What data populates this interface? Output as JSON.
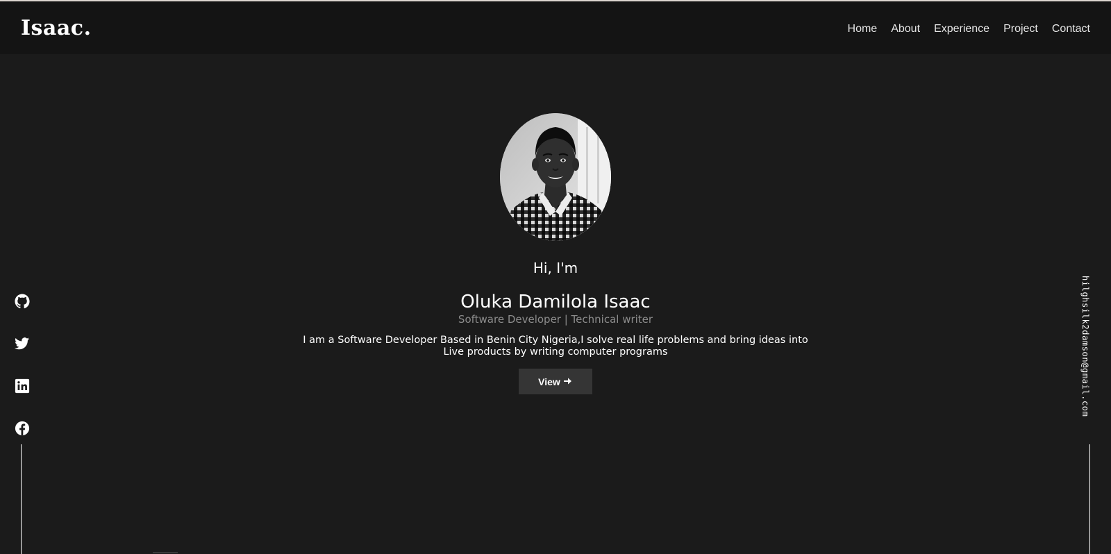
{
  "brand": {
    "name": "Isaac."
  },
  "nav": {
    "items": [
      {
        "label": "Home"
      },
      {
        "label": "About"
      },
      {
        "label": "Experience"
      },
      {
        "label": "Project"
      },
      {
        "label": "Contact"
      }
    ]
  },
  "hero": {
    "greeting": "Hi, I'm",
    "name": "Oluka Damilola Isaac",
    "role": "Software Developer | Technical writer",
    "bio": "I am a Software Developer Based in Benin City Nigeria,I solve real life problems and bring ideas into Live products by writing computer programs",
    "button_label": "View",
    "button_icon": "arrow-right-icon"
  },
  "social": {
    "icons": [
      "github-icon",
      "twitter-icon",
      "linkedin-icon",
      "facebook-icon"
    ]
  },
  "email": {
    "text": "hilghsilk2damson@gmail.com"
  },
  "colors": {
    "background": "#1b1b1b",
    "navbar": "#141414",
    "button": "#353535",
    "muted_text": "#8c8c8c",
    "text": "#ffffff"
  }
}
